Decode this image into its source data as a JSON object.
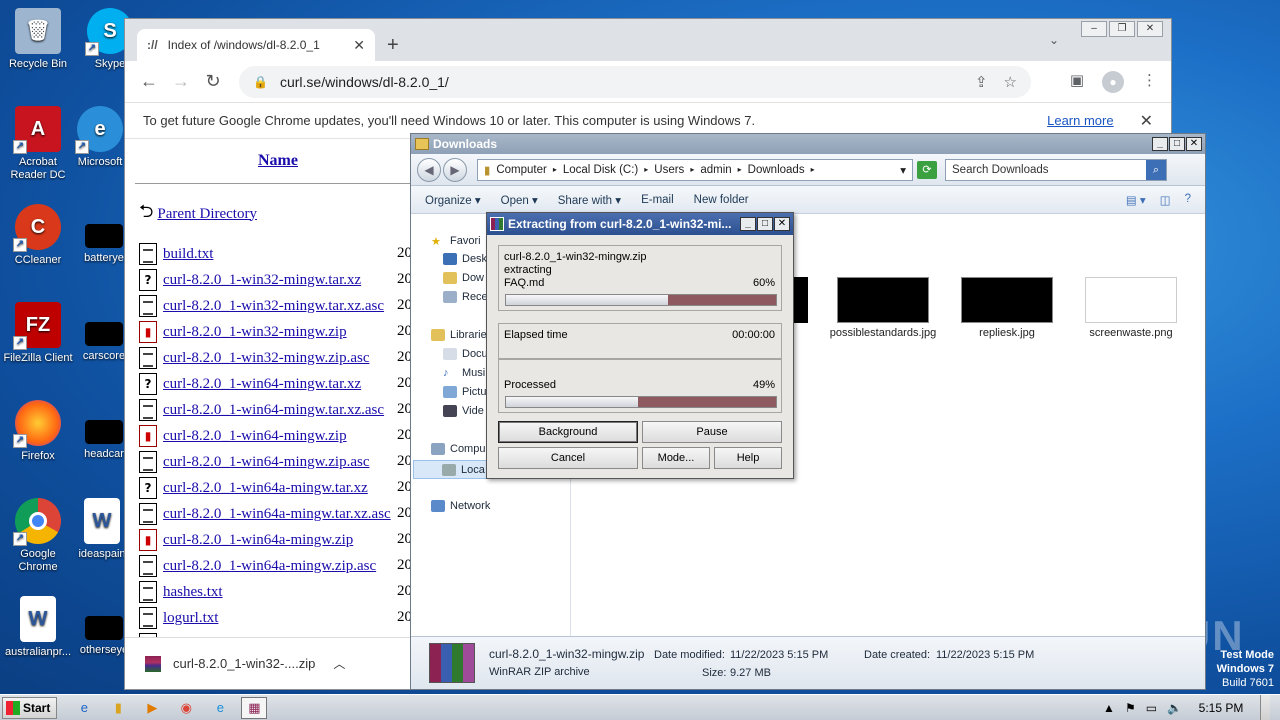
{
  "desktop": {
    "icons": [
      {
        "label": "Recycle Bin"
      },
      {
        "label": "Skype"
      },
      {
        "label": "Acrobat Reader DC"
      },
      {
        "label": "Microsoft"
      },
      {
        "label": "CCleaner"
      },
      {
        "label": "batterye"
      },
      {
        "label": "FileZilla Client"
      },
      {
        "label": "carscore"
      },
      {
        "label": "Firefox"
      },
      {
        "label": "headcar"
      },
      {
        "label": "Google Chrome"
      },
      {
        "label": "ideaspain"
      },
      {
        "label": "australianpr..."
      },
      {
        "label": "otherseye"
      }
    ],
    "watermark": "ANY RUN",
    "test_mode": {
      "line1": "Test Mode",
      "line2": "Windows 7",
      "line3": "Build 7601"
    }
  },
  "chrome": {
    "tab_title": "Index of /windows/dl-8.2.0_1",
    "tab_favicon": "://",
    "new_tab": "+",
    "url": "curl.se/windows/dl-8.2.0_1/",
    "infobar": {
      "message": "To get future Google Chrome updates, you'll need Windows 10 or later. This computer is using Windows 7.",
      "link": "Learn more"
    },
    "listing": {
      "header_name": "Name",
      "parent": "Parent Directory",
      "files": [
        {
          "name": "build.txt",
          "icon": "txt"
        },
        {
          "name": "curl-8.2.0_1-win32-mingw.tar.xz",
          "icon": "unknown"
        },
        {
          "name": "curl-8.2.0_1-win32-mingw.tar.xz.asc",
          "icon": "txt"
        },
        {
          "name": "curl-8.2.0_1-win32-mingw.zip",
          "icon": "zip"
        },
        {
          "name": "curl-8.2.0_1-win32-mingw.zip.asc",
          "icon": "txt"
        },
        {
          "name": "curl-8.2.0_1-win64-mingw.tar.xz",
          "icon": "unknown"
        },
        {
          "name": "curl-8.2.0_1-win64-mingw.tar.xz.asc",
          "icon": "txt"
        },
        {
          "name": "curl-8.2.0_1-win64-mingw.zip",
          "icon": "zip"
        },
        {
          "name": "curl-8.2.0_1-win64-mingw.zip.asc",
          "icon": "txt"
        },
        {
          "name": "curl-8.2.0_1-win64a-mingw.tar.xz",
          "icon": "unknown"
        },
        {
          "name": "curl-8.2.0_1-win64a-mingw.tar.xz.asc",
          "icon": "txt"
        },
        {
          "name": "curl-8.2.0_1-win64a-mingw.zip",
          "icon": "zip"
        },
        {
          "name": "curl-8.2.0_1-win64a-mingw.zip.asc",
          "icon": "txt"
        },
        {
          "name": "hashes.txt",
          "icon": "txt"
        },
        {
          "name": "logurl.txt",
          "icon": "txt"
        },
        {
          "name": "urls.txt",
          "icon": "txt"
        }
      ],
      "date_prefix": "20"
    },
    "download": {
      "filename": "curl-8.2.0_1-win32-....zip"
    }
  },
  "explorer": {
    "title": "Downloads",
    "breadcrumb": [
      "Computer",
      "Local Disk (C:)",
      "Users",
      "admin",
      "Downloads"
    ],
    "search_placeholder": "Search Downloads",
    "commands": [
      "Organize",
      "Open",
      "Share with",
      "E-mail",
      "New folder"
    ],
    "nav": {
      "favorites": "Favori",
      "desktop": "Desk",
      "downloads": "Dow",
      "recent": "Rece",
      "libraries": "Librarie",
      "documents": "Docu",
      "music": "Musi",
      "pictures": "Pictu",
      "videos": "Vide",
      "computer": "Compu",
      "local": "Loca",
      "network": "Network"
    },
    "files": [
      {
        "name": "possiblestandards.jpg"
      },
      {
        "name": "repliesk.jpg"
      },
      {
        "name": "screenwaste.png"
      }
    ],
    "status": {
      "filename": "curl-8.2.0_1-win32-mingw.zip",
      "type": "WinRAR ZIP archive",
      "modified_label": "Date modified:",
      "modified": "11/22/2023 5:15 PM",
      "size_label": "Size:",
      "size": "9.27 MB",
      "created_label": "Date created:",
      "created": "11/22/2023 5:15 PM"
    }
  },
  "winrar": {
    "title": "Extracting from curl-8.2.0_1-win32-mi...",
    "archive": "curl-8.2.0_1-win32-mingw.zip",
    "action": "extracting",
    "current_file": "FAQ.md",
    "file_percent_label": "60%",
    "file_progress": 0.6,
    "elapsed_label": "Elapsed time",
    "elapsed": "00:00:00",
    "processed_label": "Processed",
    "processed_percent_label": "49%",
    "processed_progress": 0.49,
    "buttons": {
      "background": "Background",
      "pause": "Pause",
      "cancel": "Cancel",
      "mode": "Mode...",
      "help": "Help"
    }
  },
  "taskbar": {
    "start": "Start",
    "clock": "5:15 PM"
  }
}
